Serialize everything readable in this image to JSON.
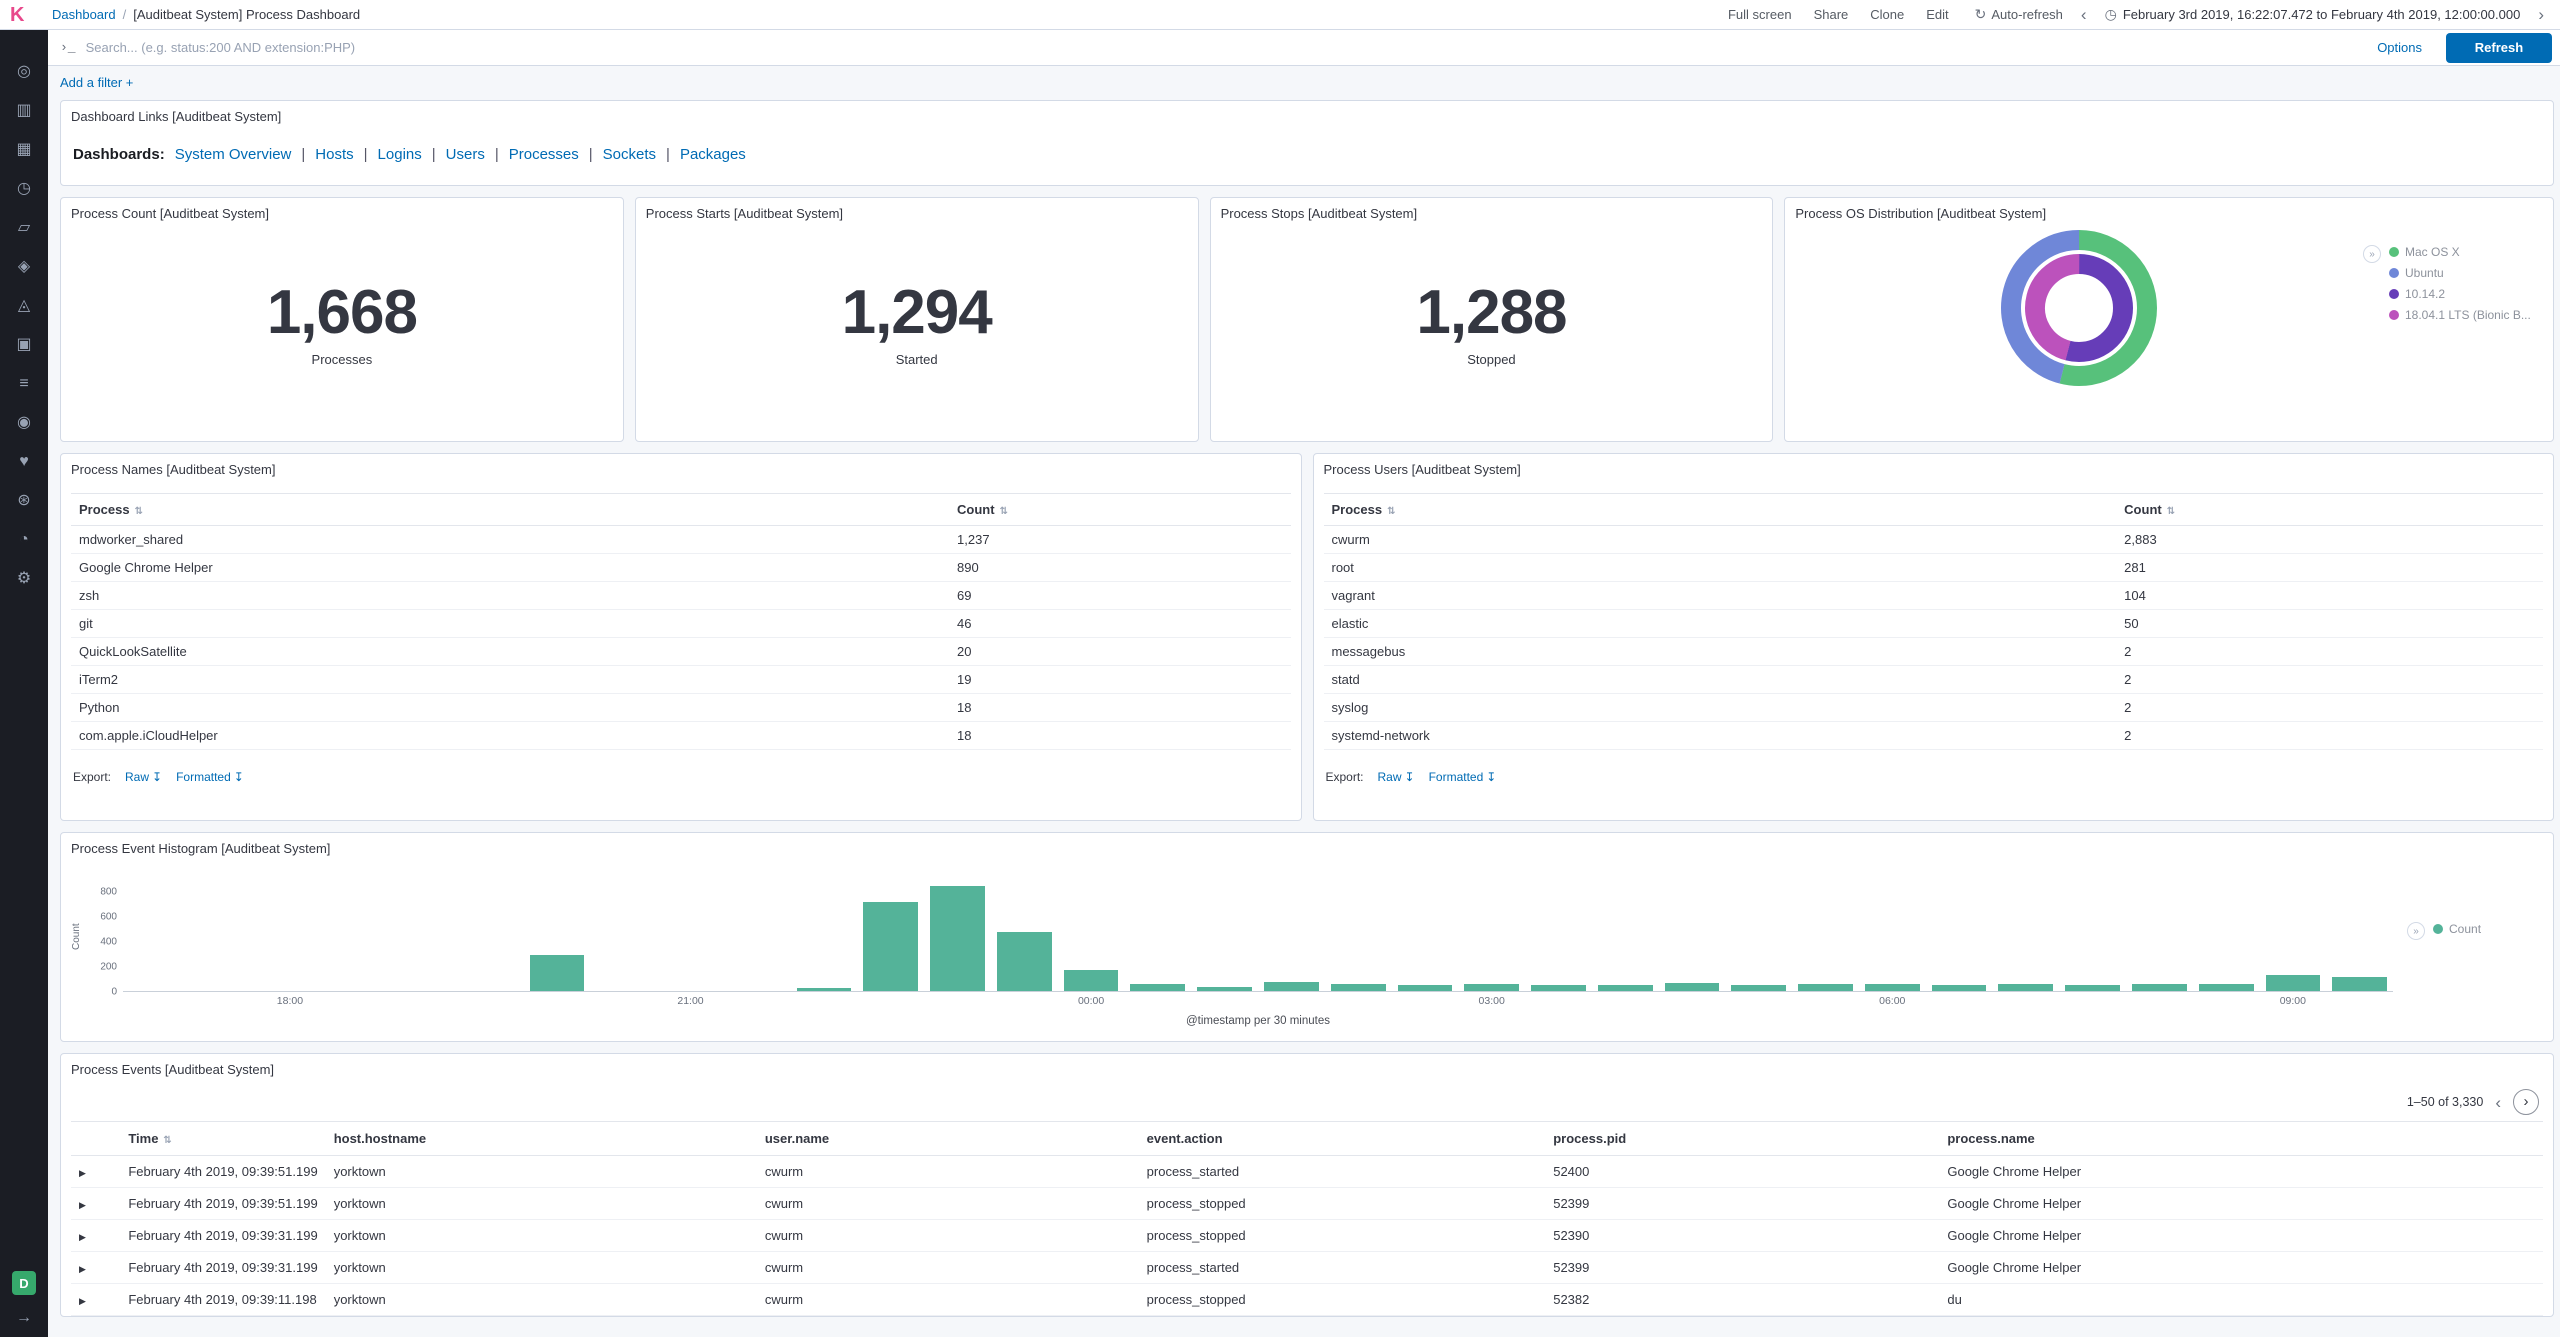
{
  "ui": {
    "legend_toggle_glyph": "»",
    "chevron_left": "‹",
    "chevron_right": "›",
    "expand_row_glyph": "▶",
    "sort_glyph": "⇅",
    "download_glyph": "↧",
    "clock_glyph": "◷",
    "auto_refresh_glyph": "↻",
    "prompt_glyph": "›_",
    "breadcrumb_sep": "/"
  },
  "header": {
    "logo_letter": "K",
    "breadcrumb": {
      "link": "Dashboard",
      "current": "[Auditbeat System] Process Dashboard"
    },
    "actions": [
      "Full screen",
      "Share",
      "Clone",
      "Edit"
    ],
    "auto_refresh_label": "Auto-refresh",
    "time_range": "February 3rd 2019, 16:22:07.472 to February 4th 2019, 12:00:00.000"
  },
  "query_bar": {
    "placeholder": "Search... (e.g. status:200 AND extension:PHP)",
    "options_label": "Options",
    "refresh_label": "Refresh"
  },
  "filter_bar": {
    "add_filter_label": "Add a filter +"
  },
  "sidebar": {
    "items": [
      {
        "name": "sidebar-item-discover",
        "glyph": "◎"
      },
      {
        "name": "sidebar-item-visualize",
        "glyph": "▥"
      },
      {
        "name": "sidebar-item-dashboard",
        "glyph": "▦"
      },
      {
        "name": "sidebar-item-timelion",
        "glyph": "◷"
      },
      {
        "name": "sidebar-item-canvas",
        "glyph": "▱"
      },
      {
        "name": "sidebar-item-maps",
        "glyph": "◈"
      },
      {
        "name": "sidebar-item-machine-learning",
        "glyph": "◬"
      },
      {
        "name": "sidebar-item-infrastructure",
        "glyph": "▣"
      },
      {
        "name": "sidebar-item-logs",
        "glyph": "≡"
      },
      {
        "name": "sidebar-item-apm",
        "glyph": "◉"
      },
      {
        "name": "sidebar-item-uptime",
        "glyph": "♥"
      },
      {
        "name": "sidebar-item-dev-tools",
        "glyph": "⊛"
      },
      {
        "name": "sidebar-item-monitoring",
        "glyph": "◔"
      },
      {
        "name": "sidebar-item-management",
        "glyph": "⚙"
      }
    ],
    "space_badge": "D",
    "collapse_glyph": "→"
  },
  "panels": {
    "links": {
      "title": "Dashboard Links [Auditbeat System]",
      "prefix": "Dashboards:",
      "links": [
        "System Overview",
        "Hosts",
        "Logins",
        "Users",
        "Processes",
        "Sockets",
        "Packages"
      ]
    },
    "metrics": [
      {
        "title": "Process Count [Auditbeat System]",
        "value": "1,668",
        "label": "Processes"
      },
      {
        "title": "Process Starts [Auditbeat System]",
        "value": "1,294",
        "label": "Started"
      },
      {
        "title": "Process Stops [Auditbeat System]",
        "value": "1,288",
        "label": "Stopped"
      }
    ],
    "os": {
      "title": "Process OS Distribution [Auditbeat System]",
      "legend": [
        {
          "label": "Mac OS X",
          "color": "#57c17b"
        },
        {
          "label": "Ubuntu",
          "color": "#6f87d8"
        },
        {
          "label": "10.14.2",
          "color": "#663db8"
        },
        {
          "label": "18.04.1 LTS (Bionic B...",
          "color": "#bc52bc"
        }
      ]
    },
    "names_table": {
      "title": "Process Names [Auditbeat System]",
      "columns": [
        "Process",
        "Count"
      ],
      "rows": [
        {
          "process": "mdworker_shared",
          "count": "1,237"
        },
        {
          "process": "Google Chrome Helper",
          "count": "890"
        },
        {
          "process": "zsh",
          "count": "69"
        },
        {
          "process": "git",
          "count": "46"
        },
        {
          "process": "QuickLookSatellite",
          "count": "20"
        },
        {
          "process": "iTerm2",
          "count": "19"
        },
        {
          "process": "Python",
          "count": "18"
        },
        {
          "process": "com.apple.iCloudHelper",
          "count": "18"
        }
      ],
      "export": {
        "label": "Export:",
        "raw": "Raw",
        "formatted": "Formatted"
      }
    },
    "users_table": {
      "title": "Process Users [Auditbeat System]",
      "columns": [
        "Process",
        "Count"
      ],
      "rows": [
        {
          "process": "cwurm",
          "count": "2,883"
        },
        {
          "process": "root",
          "count": "281"
        },
        {
          "process": "vagrant",
          "count": "104"
        },
        {
          "process": "elastic",
          "count": "50"
        },
        {
          "process": "messagebus",
          "count": "2"
        },
        {
          "process": "statd",
          "count": "2"
        },
        {
          "process": "syslog",
          "count": "2"
        },
        {
          "process": "systemd-network",
          "count": "2"
        }
      ],
      "export": {
        "label": "Export:",
        "raw": "Raw",
        "formatted": "Formatted"
      }
    },
    "histogram": {
      "title": "Process Event Histogram [Auditbeat System]",
      "legend_label": "Count"
    },
    "events": {
      "title": "Process Events [Auditbeat System]",
      "page_info": "1–50 of 3,330",
      "columns": [
        "Time",
        "host.hostname",
        "user.name",
        "event.action",
        "process.pid",
        "process.name"
      ],
      "rows": [
        {
          "time": "February 4th 2019, 09:39:51.199",
          "host": "yorktown",
          "user": "cwurm",
          "action": "process_started",
          "pid": "52400",
          "name": "Google Chrome Helper"
        },
        {
          "time": "February 4th 2019, 09:39:51.199",
          "host": "yorktown",
          "user": "cwurm",
          "action": "process_stopped",
          "pid": "52399",
          "name": "Google Chrome Helper"
        },
        {
          "time": "February 4th 2019, 09:39:31.199",
          "host": "yorktown",
          "user": "cwurm",
          "action": "process_stopped",
          "pid": "52390",
          "name": "Google Chrome Helper"
        },
        {
          "time": "February 4th 2019, 09:39:31.199",
          "host": "yorktown",
          "user": "cwurm",
          "action": "process_started",
          "pid": "52399",
          "name": "Google Chrome Helper"
        },
        {
          "time": "February 4th 2019, 09:39:11.198",
          "host": "yorktown",
          "user": "cwurm",
          "action": "process_stopped",
          "pid": "52382",
          "name": "du"
        }
      ]
    }
  },
  "chart_data": [
    {
      "type": "bar",
      "title": "Process Event Histogram [Auditbeat System]",
      "xlabel": "@timestamp per 30 minutes",
      "ylabel": "Count",
      "legend": [
        "Count"
      ],
      "color": "#54b399",
      "bucket_minutes": 30,
      "x": [
        "17:00",
        "17:30",
        "18:00",
        "18:30",
        "19:00",
        "19:30",
        "20:00",
        "20:30",
        "21:00",
        "21:30",
        "22:00",
        "22:30",
        "23:00",
        "23:30",
        "00:00",
        "00:30",
        "01:00",
        "01:30",
        "02:00",
        "02:30",
        "03:00",
        "03:30",
        "04:00",
        "04:30",
        "05:00",
        "05:30",
        "06:00",
        "06:30",
        "07:00",
        "07:30",
        "08:00",
        "08:30",
        "09:00",
        "09:30"
      ],
      "values": [
        0,
        0,
        0,
        0,
        0,
        0,
        290,
        0,
        0,
        0,
        25,
        720,
        850,
        480,
        170,
        60,
        35,
        70,
        55,
        45,
        60,
        50,
        45,
        65,
        50,
        55,
        60,
        45,
        55,
        50,
        60,
        55,
        130,
        115
      ],
      "y_ticks": [
        0,
        200,
        400,
        600,
        800
      ],
      "ymax": 880,
      "x_tick_indices": [
        2,
        8,
        14,
        20,
        26,
        32
      ],
      "x_tick_labels": [
        "18:00",
        "21:00",
        "00:00",
        "03:00",
        "06:00",
        "09:00"
      ],
      "grid": false,
      "legend_position": "right"
    },
    {
      "type": "pie",
      "title": "Process OS Distribution [Auditbeat System]",
      "legend": [
        "Mac OS X",
        "Ubuntu",
        "10.14.2",
        "18.04.1 LTS (Bionic B..."
      ],
      "legend_position": "right",
      "rings": {
        "outer": [
          {
            "label": "Mac OS X",
            "color": "#57c17b",
            "pct": 54
          },
          {
            "label": "Ubuntu",
            "color": "#6f87d8",
            "pct": 46
          }
        ],
        "inner": [
          {
            "label": "10.14.2",
            "color": "#663db8",
            "pct": 54
          },
          {
            "label": "18.04.1 LTS (Bionic B...",
            "color": "#bc52bc",
            "pct": 46
          }
        ]
      }
    }
  ]
}
